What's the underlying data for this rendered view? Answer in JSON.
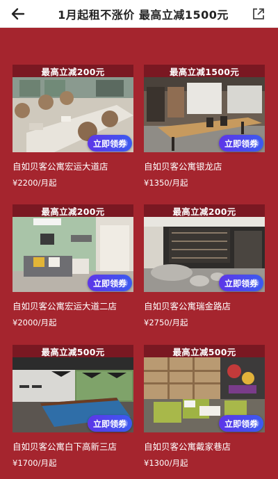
{
  "header": {
    "title": "1月起租不涨价 最高立减1500元",
    "back_icon": "arrow-left-icon",
    "share_icon": "external-link-icon"
  },
  "colors": {
    "background": "#a5252e",
    "tag": "#7a1822",
    "button_start": "#5d36e8",
    "button_end": "#3b5bf0"
  },
  "listings": [
    {
      "tag": "最高立减200元",
      "name": "自如贝客公寓宏运大道店",
      "price": "¥2200/月起",
      "button": "立即领券"
    },
    {
      "tag": "最高立减1500元",
      "name": "自如贝客公寓银龙店",
      "price": "¥1350/月起",
      "button": "立即领券"
    },
    {
      "tag": "最高立减200元",
      "name": "自如贝客公寓宏运大道二店",
      "price": "¥2000/月起",
      "button": "立即领券"
    },
    {
      "tag": "最高立减200元",
      "name": "自如贝客公寓瑞金路店",
      "price": "¥2750/月起",
      "button": "立即领券"
    },
    {
      "tag": "最高立减500元",
      "name": "自如贝客公寓白下高新三店",
      "price": "¥1700/月起",
      "button": "立即领券"
    },
    {
      "tag": "最高立减500元",
      "name": "自如贝客公寓戴家巷店",
      "price": "¥1300/月起",
      "button": "立即领券"
    }
  ]
}
